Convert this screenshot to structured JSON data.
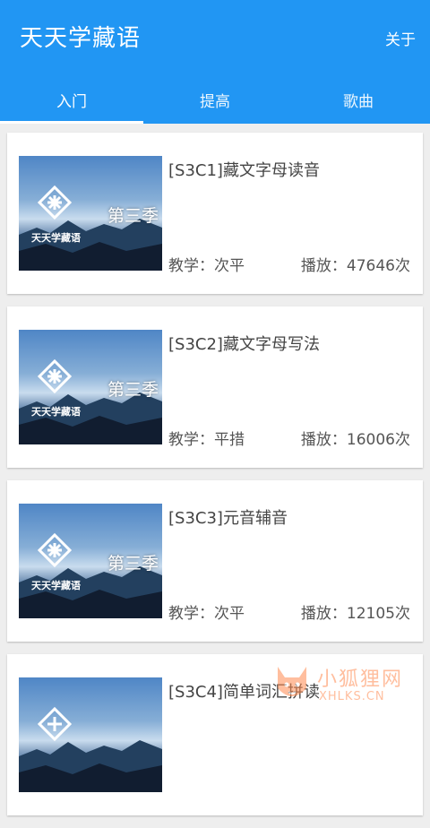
{
  "header": {
    "title": "天天学藏语",
    "about": "关于"
  },
  "tabs": [
    {
      "label": "入门",
      "active": true
    },
    {
      "label": "提高",
      "active": false
    },
    {
      "label": "歌曲",
      "active": false
    }
  ],
  "thumbnail": {
    "season_text": "第三季",
    "brand_text": "天天学藏语"
  },
  "items": [
    {
      "title": "[S3C1]藏文字母读音",
      "teacher": "教学：次平",
      "plays": "播放：47646次"
    },
    {
      "title": "[S3C2]藏文字母写法",
      "teacher": "教学：平措",
      "plays": "播放：16006次"
    },
    {
      "title": "[S3C3]元音辅音",
      "teacher": "教学：次平",
      "plays": "播放：12105次"
    },
    {
      "title": "[S3C4]简单词汇拼读",
      "teacher": "",
      "plays": ""
    }
  ],
  "watermark": {
    "cn": "小狐狸网",
    "en": "XHLKS.CN"
  },
  "colors": {
    "primary": "#2196f3",
    "background": "#eeeeee",
    "watermark": "#ff8a50"
  }
}
